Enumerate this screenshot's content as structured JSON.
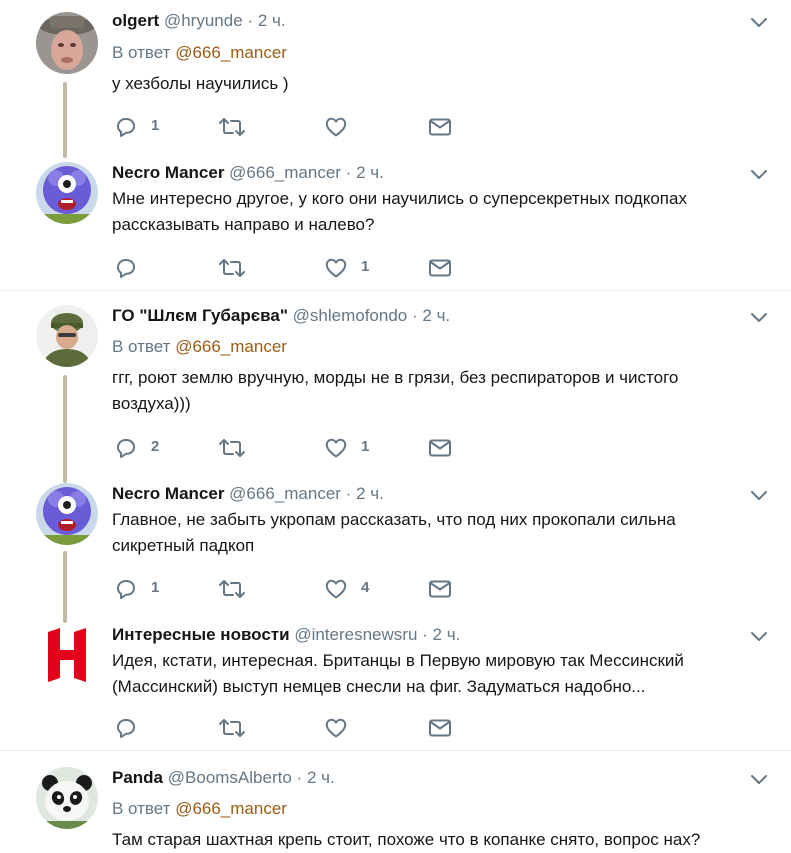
{
  "tweets": [
    {
      "name": "olgert",
      "handle": "@hryunde",
      "dot": "·",
      "time": "2 ч.",
      "reply_prefix": "В ответ",
      "reply_to": "@666_mancer",
      "text": "у хезболы научились )",
      "counts": {
        "reply": "1",
        "retweet": "",
        "like": ""
      }
    },
    {
      "name": "Necro Mancer",
      "handle": "@666_mancer",
      "dot": "·",
      "time": "2 ч.",
      "text": "Мне интересно другое, у кого они научились о суперсекретных подкопах рассказывать направо и налево?",
      "counts": {
        "reply": "",
        "retweet": "",
        "like": "1"
      }
    },
    {
      "name": "ГО \"Шлєм Губарєва\"",
      "handle": "@shlemofondo",
      "dot": "·",
      "time": "2 ч.",
      "reply_prefix": "В ответ",
      "reply_to": "@666_mancer",
      "text": "ггг, роют землю вручную, морды не в грязи, без респираторов и чистого воздуха)))",
      "counts": {
        "reply": "2",
        "retweet": "",
        "like": "1"
      }
    },
    {
      "name": "Necro Mancer",
      "handle": "@666_mancer",
      "dot": "·",
      "time": "2 ч.",
      "text": "Главное, не забыть укропам рассказать, что под них прокопали сильна сикретный падкоп",
      "counts": {
        "reply": "1",
        "retweet": "",
        "like": "4"
      }
    },
    {
      "name": "Интересные новости",
      "handle": "@interesnewsru",
      "dot": "·",
      "time": "2 ч.",
      "text": "Идея, кстати, интересная. Британцы в Первую мировую так Мессинский (Массинский) выступ немцев снесли на фиг. Задуматься надобно...",
      "counts": {
        "reply": "",
        "retweet": "",
        "like": ""
      }
    },
    {
      "name": "Panda",
      "handle": "@BoomsAlberto",
      "dot": "·",
      "time": "2 ч.",
      "reply_prefix": "В ответ",
      "reply_to": "@666_mancer",
      "text": "Там старая шахтная крепь стоит, похоже что в копанке снято, вопрос нах?"
    }
  ],
  "colors": {
    "link": "#9a5c13",
    "muted": "#657786",
    "thread_line": "#c3b8a3",
    "news_logo": "#e3001b"
  },
  "icons": [
    "reply-icon",
    "retweet-icon",
    "like-icon",
    "message-icon",
    "chevron-down-icon"
  ]
}
